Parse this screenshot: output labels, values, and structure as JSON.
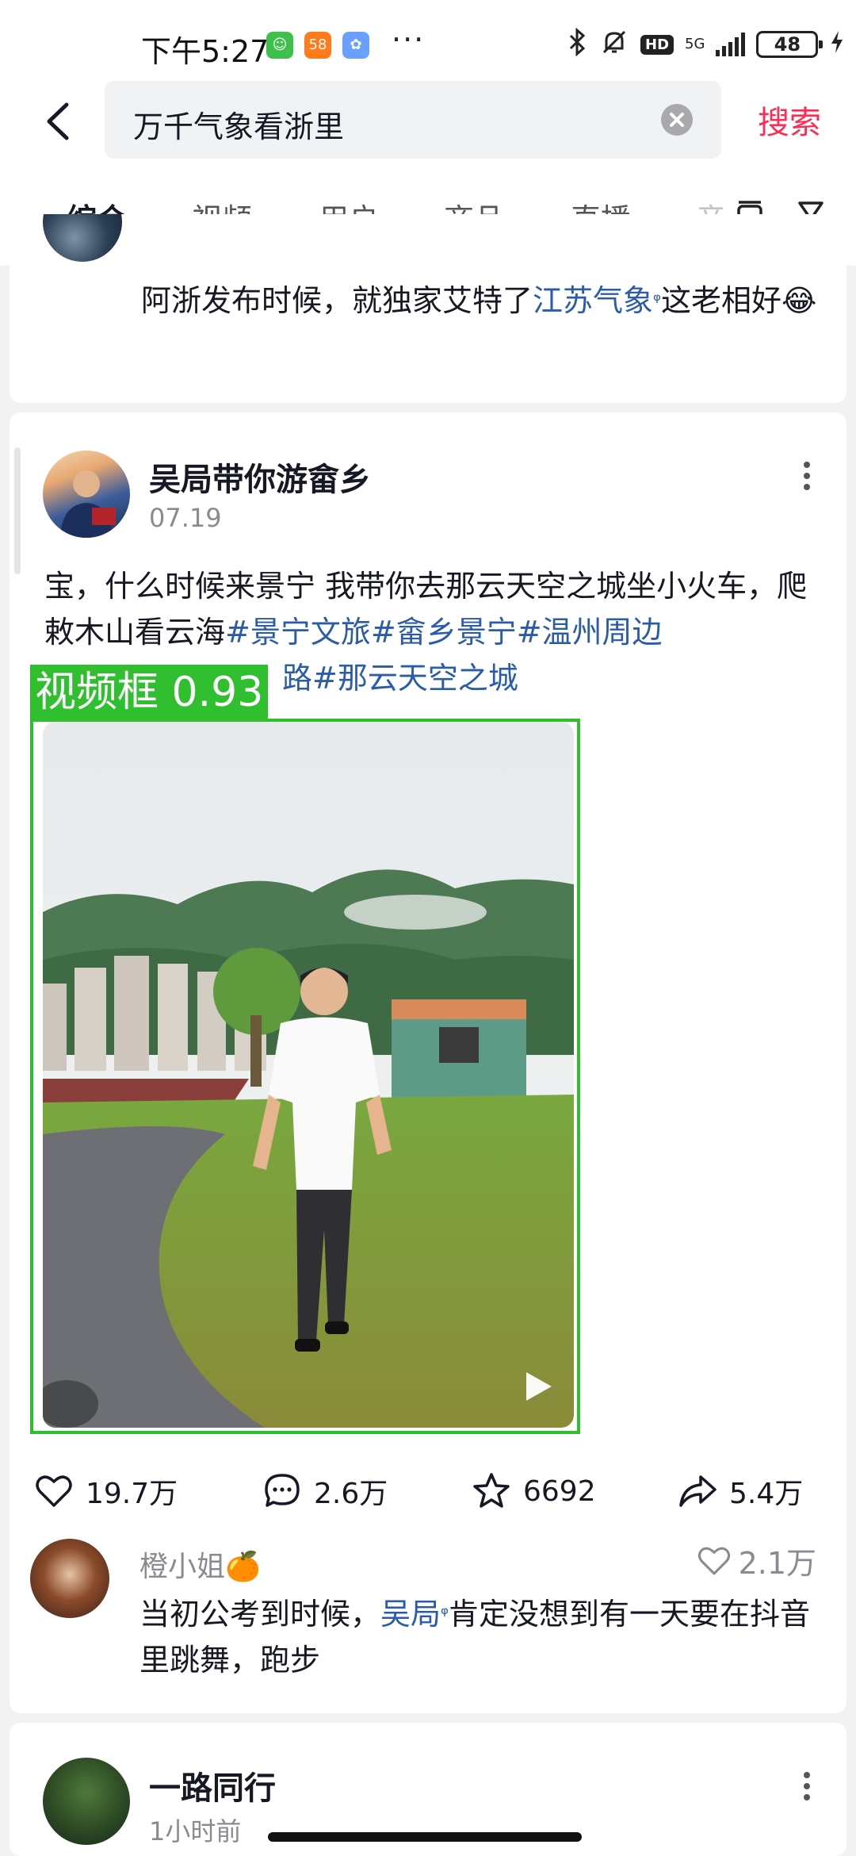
{
  "status_bar": {
    "time": "下午5:27",
    "network": "5G",
    "hd": "HD",
    "battery": "48",
    "more": "···"
  },
  "search": {
    "query": "万千气象看浙里",
    "submit_label": "搜索"
  },
  "tabs": [
    {
      "label": "综合",
      "active": true
    },
    {
      "label": "视频"
    },
    {
      "label": "用户"
    },
    {
      "label": "商品"
    },
    {
      "label": "直播"
    },
    {
      "label": "音"
    }
  ],
  "previous_comment": {
    "text_before": "阿浙发布时候，就独家艾特了",
    "link": "江苏气象",
    "text_after": "这老相好",
    "emoji": "😂"
  },
  "post": {
    "author": "吴局带你游畲乡",
    "date": "07.19",
    "text": "宝，什么时候来景宁 我带你去那云天空之城坐小火车，爬敕木山看云海",
    "hashtags": [
      "#景宁文旅",
      "#畲乡景宁",
      "#温州周边",
      "路",
      "#那云天空之城"
    ],
    "detection_label": "视频框 0.93",
    "stats": {
      "likes": "19.7万",
      "comments": "2.6万",
      "favorites": "6692",
      "shares": "5.4万"
    },
    "top_comment": {
      "name": "橙小姐🍊",
      "likes": "2.1万",
      "text_before": "当初公考到时候，",
      "link": "吴局",
      "text_after": "肯定没想到有一天要在抖音里跳舞，跑步"
    }
  },
  "next_post": {
    "author": "一路同行",
    "sub": "1小时前"
  },
  "colors": {
    "accent": "#fe2c55",
    "link": "#2a5caa",
    "detection": "#2fbf2f"
  }
}
